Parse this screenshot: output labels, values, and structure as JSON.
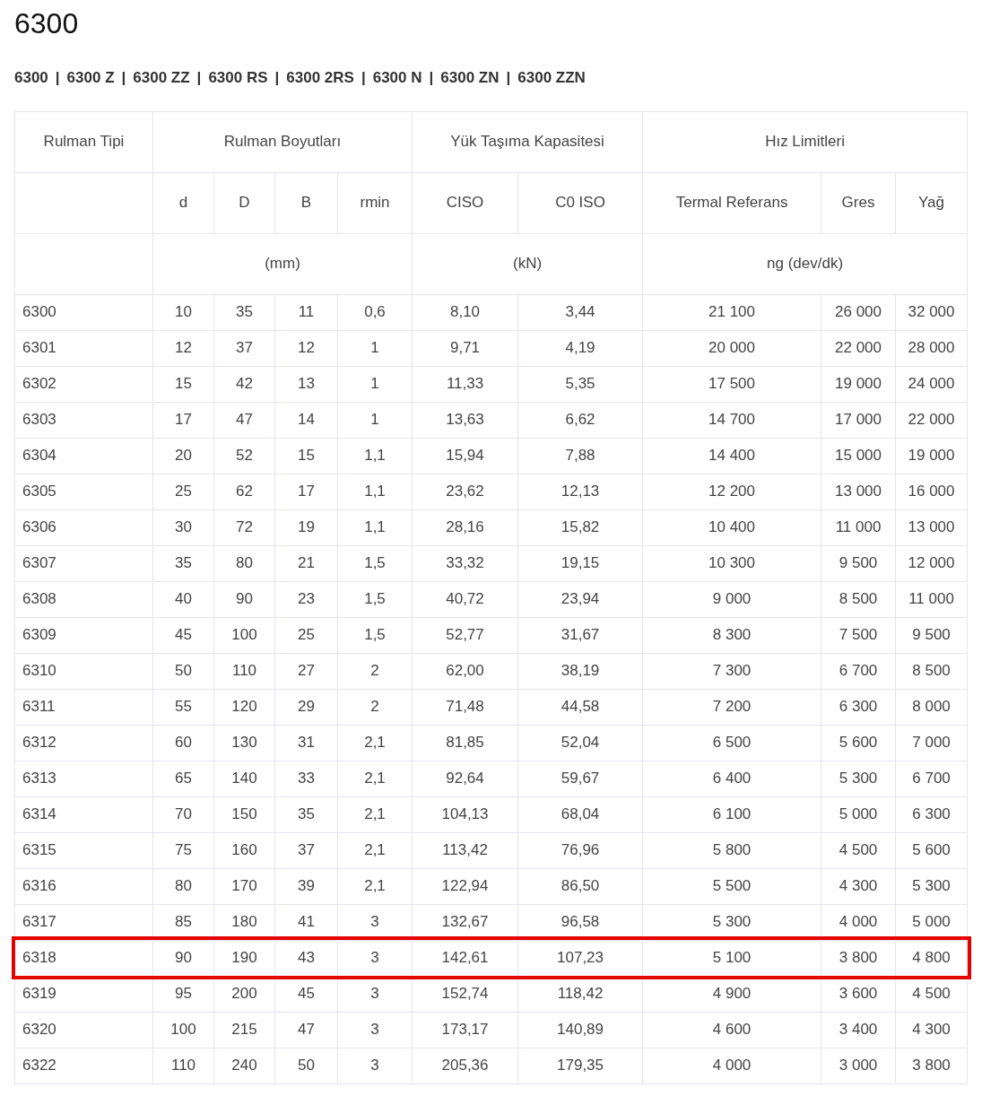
{
  "title": "6300",
  "variants": [
    "6300",
    "6300 Z",
    "6300 ZZ",
    "6300 RS",
    "6300 2RS",
    "6300 N",
    "6300 ZN",
    "6300 ZZN"
  ],
  "separator": "|",
  "table": {
    "group_headers": [
      "Rulman Tipi",
      "Rulman Boyutları",
      "Yük Taşıma Kapasitesi",
      "Hız Limitleri"
    ],
    "columns": [
      "",
      "d",
      "D",
      "B",
      "rmin",
      "CISO",
      "C0 ISO",
      "Termal Referans",
      "Gres",
      "Yağ"
    ],
    "units": [
      "(mm)",
      "(kN)",
      "ng (dev/dk)"
    ],
    "rows": [
      {
        "cells": [
          "6300",
          "10",
          "35",
          "11",
          "0,6",
          "8,10",
          "3,44",
          "21 100",
          "26 000",
          "32 000"
        ],
        "highlighted": false
      },
      {
        "cells": [
          "6301",
          "12",
          "37",
          "12",
          "1",
          "9,71",
          "4,19",
          "20 000",
          "22 000",
          "28 000"
        ],
        "highlighted": false
      },
      {
        "cells": [
          "6302",
          "15",
          "42",
          "13",
          "1",
          "11,33",
          "5,35",
          "17 500",
          "19 000",
          "24 000"
        ],
        "highlighted": false
      },
      {
        "cells": [
          "6303",
          "17",
          "47",
          "14",
          "1",
          "13,63",
          "6,62",
          "14 700",
          "17 000",
          "22 000"
        ],
        "highlighted": false
      },
      {
        "cells": [
          "6304",
          "20",
          "52",
          "15",
          "1,1",
          "15,94",
          "7,88",
          "14 400",
          "15 000",
          "19 000"
        ],
        "highlighted": false
      },
      {
        "cells": [
          "6305",
          "25",
          "62",
          "17",
          "1,1",
          "23,62",
          "12,13",
          "12 200",
          "13 000",
          "16 000"
        ],
        "highlighted": false
      },
      {
        "cells": [
          "6306",
          "30",
          "72",
          "19",
          "1,1",
          "28,16",
          "15,82",
          "10 400",
          "11 000",
          "13 000"
        ],
        "highlighted": false
      },
      {
        "cells": [
          "6307",
          "35",
          "80",
          "21",
          "1,5",
          "33,32",
          "19,15",
          "10 300",
          "9 500",
          "12 000"
        ],
        "highlighted": false
      },
      {
        "cells": [
          "6308",
          "40",
          "90",
          "23",
          "1,5",
          "40,72",
          "23,94",
          "9 000",
          "8 500",
          "11 000"
        ],
        "highlighted": false
      },
      {
        "cells": [
          "6309",
          "45",
          "100",
          "25",
          "1,5",
          "52,77",
          "31,67",
          "8 300",
          "7 500",
          "9 500"
        ],
        "highlighted": false
      },
      {
        "cells": [
          "6310",
          "50",
          "110",
          "27",
          "2",
          "62,00",
          "38,19",
          "7 300",
          "6 700",
          "8 500"
        ],
        "highlighted": false
      },
      {
        "cells": [
          "6311",
          "55",
          "120",
          "29",
          "2",
          "71,48",
          "44,58",
          "7 200",
          "6 300",
          "8 000"
        ],
        "highlighted": false
      },
      {
        "cells": [
          "6312",
          "60",
          "130",
          "31",
          "2,1",
          "81,85",
          "52,04",
          "6 500",
          "5 600",
          "7 000"
        ],
        "highlighted": false
      },
      {
        "cells": [
          "6313",
          "65",
          "140",
          "33",
          "2,1",
          "92,64",
          "59,67",
          "6 400",
          "5 300",
          "6 700"
        ],
        "highlighted": false
      },
      {
        "cells": [
          "6314",
          "70",
          "150",
          "35",
          "2,1",
          "104,13",
          "68,04",
          "6 100",
          "5 000",
          "6 300"
        ],
        "highlighted": false
      },
      {
        "cells": [
          "6315",
          "75",
          "160",
          "37",
          "2,1",
          "113,42",
          "76,96",
          "5 800",
          "4 500",
          "5 600"
        ],
        "highlighted": false
      },
      {
        "cells": [
          "6316",
          "80",
          "170",
          "39",
          "2,1",
          "122,94",
          "86,50",
          "5 500",
          "4 300",
          "5 300"
        ],
        "highlighted": false
      },
      {
        "cells": [
          "6317",
          "85",
          "180",
          "41",
          "3",
          "132,67",
          "96,58",
          "5 300",
          "4 000",
          "5 000"
        ],
        "highlighted": false
      },
      {
        "cells": [
          "6318",
          "90",
          "190",
          "43",
          "3",
          "142,61",
          "107,23",
          "5 100",
          "3 800",
          "4 800"
        ],
        "highlighted": true
      },
      {
        "cells": [
          "6319",
          "95",
          "200",
          "45",
          "3",
          "152,74",
          "118,42",
          "4 900",
          "3 600",
          "4 500"
        ],
        "highlighted": false
      },
      {
        "cells": [
          "6320",
          "100",
          "215",
          "47",
          "3",
          "173,17",
          "140,89",
          "4 600",
          "3 400",
          "4 300"
        ],
        "highlighted": false
      },
      {
        "cells": [
          "6322",
          "110",
          "240",
          "50",
          "3",
          "205,36",
          "179,35",
          "4 000",
          "3 000",
          "3 800"
        ],
        "highlighted": false
      }
    ]
  }
}
